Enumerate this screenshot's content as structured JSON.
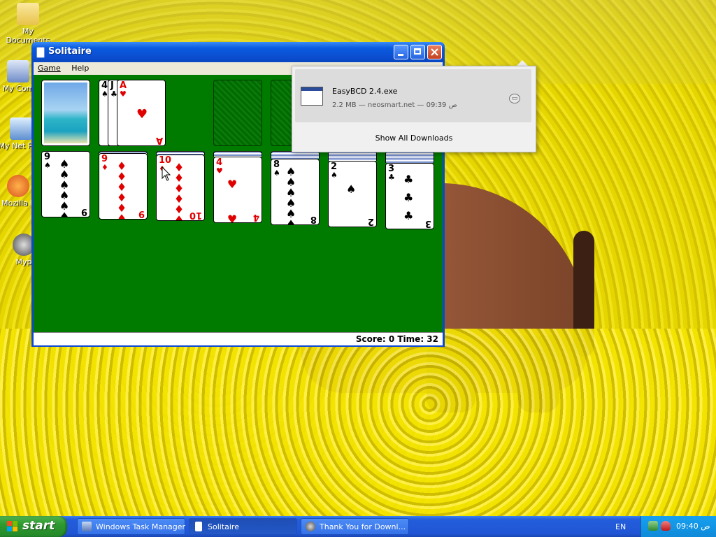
{
  "desktop": {
    "icons": [
      {
        "label": "My Documents"
      },
      {
        "label": "My Com"
      },
      {
        "label": "My Net Plac"
      },
      {
        "label": "Mozilla F"
      },
      {
        "label": "Myp"
      }
    ]
  },
  "solitaire": {
    "title": "Solitaire",
    "menu": [
      "Game",
      "Help"
    ],
    "status": "Score: 0 Time: 32",
    "waste": [
      {
        "rank": "4",
        "suit": "♠",
        "color": "black"
      },
      {
        "rank": "J",
        "suit": "♣",
        "color": "black"
      },
      {
        "rank": "A",
        "suit": "♥",
        "color": "red"
      }
    ],
    "tableau": [
      {
        "rank": "9",
        "suit": "♠",
        "color": "black",
        "pips": "♠ ♠ ♠ ♠ ♠ ♠ ♠ ♠ ♠",
        "hidden": 0
      },
      {
        "rank": "9",
        "suit": "♦",
        "color": "red",
        "pips": "♦ ♦ ♦ ♦ ♦ ♦ ♦ ♦ ♦",
        "hidden": 1
      },
      {
        "rank": "10",
        "suit": "♦",
        "color": "red",
        "pips": "♦ ♦ ♦ ♦ ♦ ♦ ♦ ♦ ♦ ♦",
        "hidden": 2
      },
      {
        "rank": "4",
        "suit": "♥",
        "color": "red",
        "pips": "♥ ♥ ♥ ♥",
        "hidden": 3
      },
      {
        "rank": "8",
        "suit": "♠",
        "color": "black",
        "pips": "♠ ♠ ♠ ♠ ♠ ♠ ♠ ♠",
        "hidden": 4
      },
      {
        "rank": "2",
        "suit": "♠",
        "color": "black",
        "pips": "♠ ♠",
        "hidden": 5
      },
      {
        "rank": "3",
        "suit": "♣",
        "color": "black",
        "pips": "♣ ♣ ♣",
        "hidden": 6
      }
    ]
  },
  "downloads": {
    "file_name": "EasyBCD 2.4.exe",
    "meta": "2.2 MB — neosmart.net — 09:39 ص",
    "show_all": "Show All Downloads"
  },
  "taskbar": {
    "start_label": "start",
    "tasks": [
      {
        "label": "Windows Task Manager",
        "icon": "task-manager-icon"
      },
      {
        "label": "Solitaire",
        "icon": "solitaire-icon"
      },
      {
        "label": "Thank You for Downl...",
        "icon": "firefox-icon"
      }
    ],
    "language": "EN",
    "clock": "09:40 ص"
  },
  "colors": {
    "felt": "#007b00",
    "titlebar": "#0a5be0",
    "taskbar": "#245edc",
    "start_green": "#2e9a2e"
  }
}
